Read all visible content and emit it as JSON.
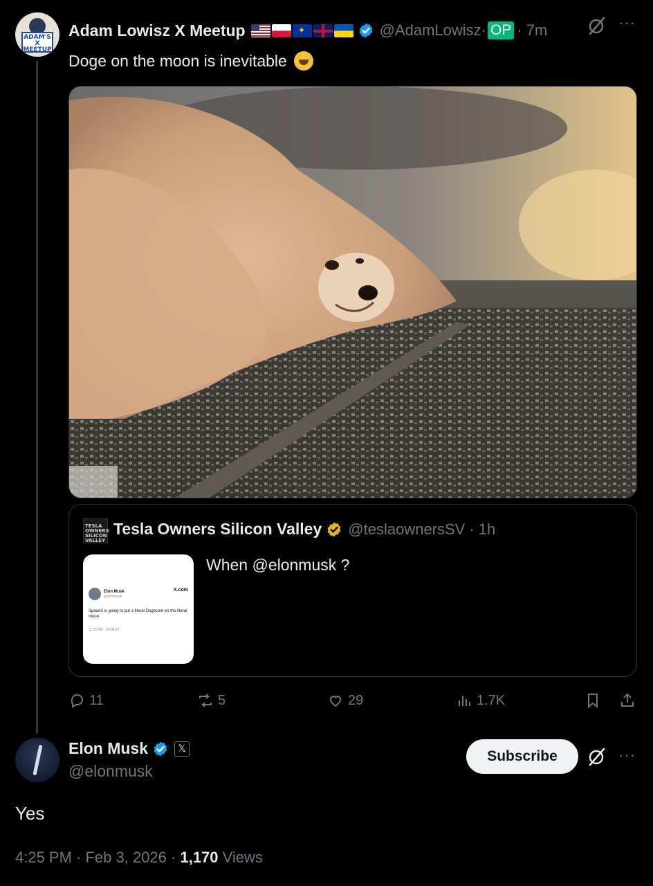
{
  "post": {
    "avatar_text": "ADAM'S X MEETUP",
    "author_name": "Adam Lowisz X Meetup",
    "flags": [
      "us-flag",
      "poland-flag",
      "eu-flag",
      "uk-flag",
      "ukraine-flag"
    ],
    "handle": "@AdamLowisz·",
    "op_badge": "OP",
    "time": "· 7m",
    "text": "Doge on the moon is inevitable",
    "emoji": "rolling-on-floor-laughing",
    "more": "···"
  },
  "quote": {
    "avatar_text": "TESLA OWNERS SILICON VALLEY",
    "author_name": "Tesla Owners Silicon Valley",
    "handle": "@teslaownersSV",
    "time": "· 1h",
    "text": "When @elonmusk ?",
    "thumb": {
      "name": "Elon Musk",
      "handle": "@elonmusk",
      "site": "X.com",
      "body": "SpaceX is going to put a literal Dogecoin on the literal moon",
      "time": "11:25 AM · 01/04/21"
    }
  },
  "actions": {
    "replies": "11",
    "reposts": "5",
    "likes": "29",
    "views": "1.7K"
  },
  "reply": {
    "author_name": "Elon Musk",
    "x_badge": "𝕏",
    "handle": "@elonmusk",
    "subscribe_label": "Subscribe",
    "more": "···",
    "text": "Yes",
    "timestamp": "4:25 PM · Feb 3, 2026 · ",
    "views_count": "1,170",
    "views_label": " Views"
  },
  "colors": {
    "background": "#000000",
    "text": "#e7e9ea",
    "muted": "#71767b",
    "verified_blue": "#1d9bf0",
    "verified_gold": "#e2b719",
    "op_green": "#00ba7c"
  }
}
